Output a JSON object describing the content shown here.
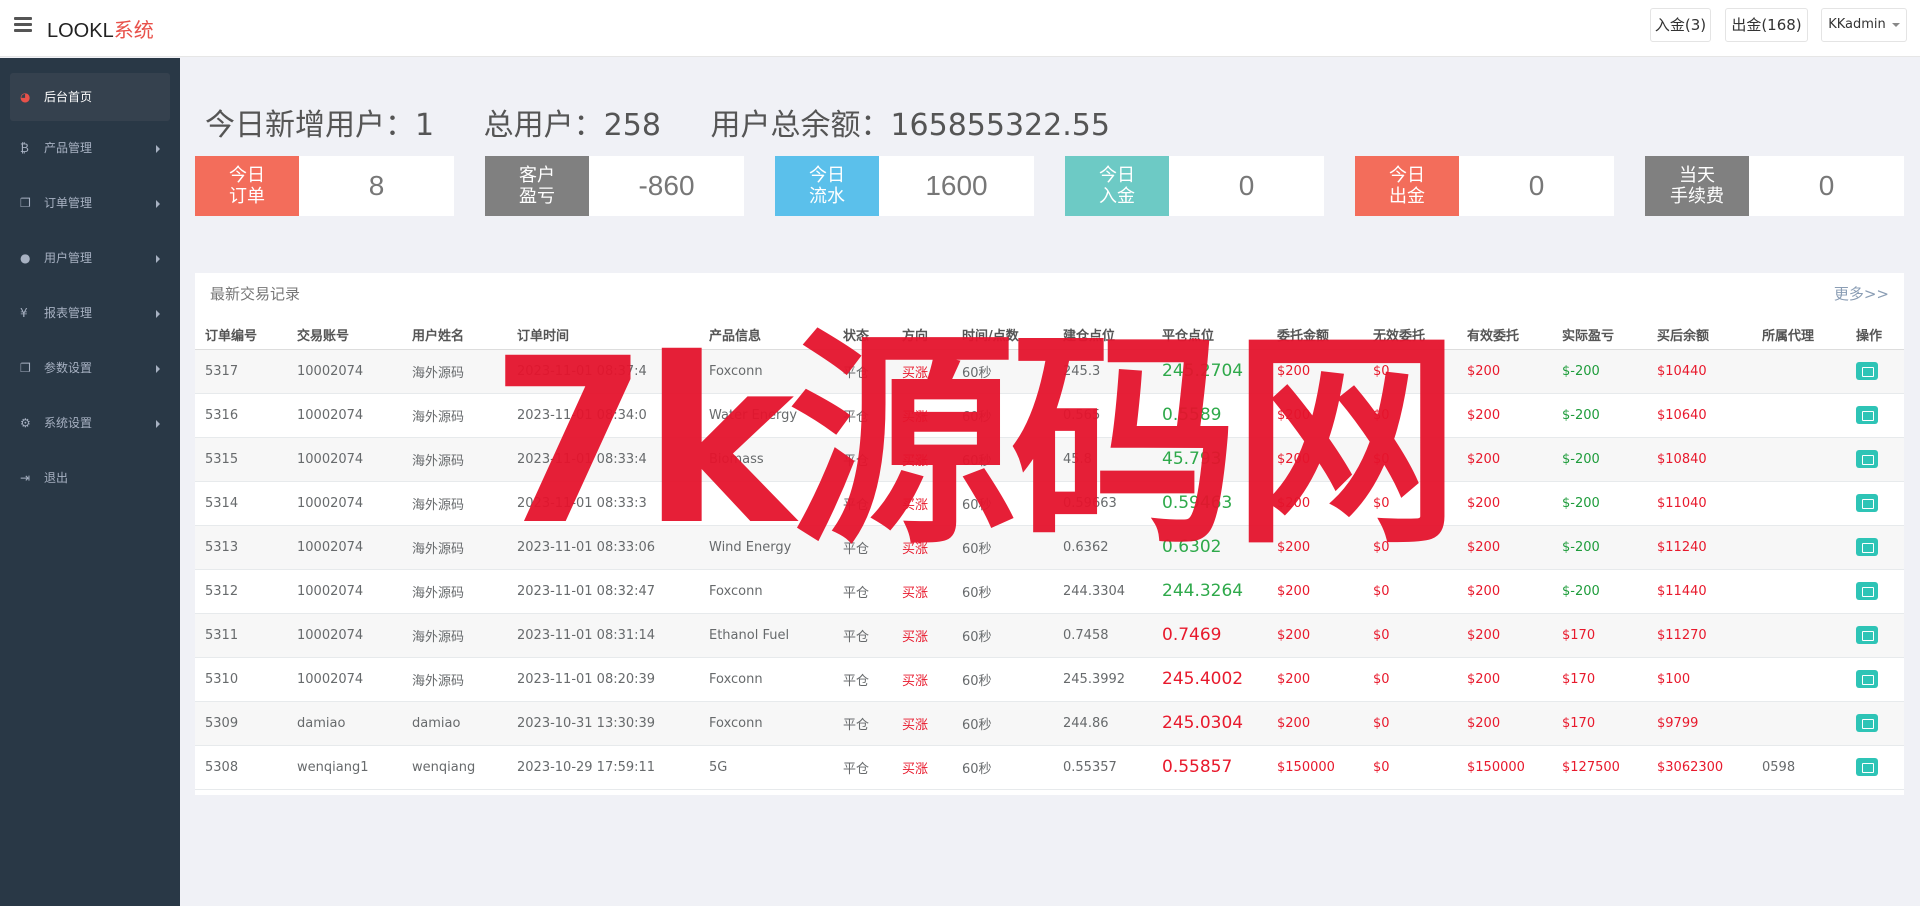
{
  "brand": {
    "name": "LOOKL",
    "suffix": "系统"
  },
  "topbar": {
    "deposit_label": "入金(3)",
    "withdraw_label": "出金(168)",
    "admin_label": "KKadmin"
  },
  "sidebar": {
    "items": [
      {
        "label": "后台首页",
        "icon": "dashboard-icon"
      },
      {
        "label": "产品管理",
        "icon": "bitcoin-icon"
      },
      {
        "label": "订单管理",
        "icon": "copy-icon"
      },
      {
        "label": "用户管理",
        "icon": "user-icon"
      },
      {
        "label": "报表管理",
        "icon": "yen-icon"
      },
      {
        "label": "参数设置",
        "icon": "copy-icon"
      },
      {
        "label": "系统设置",
        "icon": "gears-icon"
      },
      {
        "label": "退出",
        "icon": "sign-out-icon"
      }
    ]
  },
  "summary": {
    "new_users": "今日新增用户：1",
    "total_users": "总用户：258",
    "total_balance": "用户总余额：165855322.55"
  },
  "stats": [
    {
      "label1": "今日",
      "label2": "订单",
      "value": "8",
      "color": "#f36d5b"
    },
    {
      "label1": "客户",
      "label2": "盈亏",
      "value": "-860",
      "color": "#808080"
    },
    {
      "label1": "今日",
      "label2": "流水",
      "value": "1600",
      "color": "#5bc0eb"
    },
    {
      "label1": "今日",
      "label2": "入金",
      "value": "0",
      "color": "#6dcac5"
    },
    {
      "label1": "今日",
      "label2": "出金",
      "value": "0",
      "color": "#f36d5b"
    },
    {
      "label1": "当天",
      "label2": "手续费",
      "value": "0",
      "color": "#808080"
    }
  ],
  "panel": {
    "title": "最新交易记录",
    "more": "更多>>"
  },
  "table": {
    "headers": [
      "订单编号",
      "交易账号",
      "用户姓名",
      "订单时间",
      "产品信息",
      "状态",
      "方向",
      "时间/点数",
      "建仓点位",
      "平仓点位",
      "委托金额",
      "无效委托",
      "有效委托",
      "实际盈亏",
      "买后余额",
      "所属代理",
      "操作"
    ],
    "rows": [
      {
        "id": "5317",
        "account": "10002074",
        "name": "海外源码",
        "time": "2023-11-01 08:37:4",
        "product": "Foxconn",
        "status": "平仓",
        "direction": "买涨",
        "period": "60秒",
        "open": "245.3",
        "close": "245.2704",
        "close_dir": "down",
        "amount": "$200",
        "invalid": "$0",
        "valid": "$200",
        "pnl": "$-200",
        "pnl_dir": "loss",
        "balance": "$10440",
        "agent": ""
      },
      {
        "id": "5316",
        "account": "10002074",
        "name": "海外源码",
        "time": "2023-11-01 08:34:0",
        "product": "Water Energy",
        "status": "平仓",
        "direction": "买涨",
        "period": "60秒",
        "open": "0.565",
        "close": "0.5589",
        "close_dir": "down",
        "amount": "$200",
        "invalid": "$0",
        "valid": "$200",
        "pnl": "$-200",
        "pnl_dir": "loss",
        "balance": "$10640",
        "agent": ""
      },
      {
        "id": "5315",
        "account": "10002074",
        "name": "海外源码",
        "time": "2023-11-01 08:33:4",
        "product": "Biomass",
        "status": "平仓",
        "direction": "买涨",
        "period": "60秒",
        "open": "45.8",
        "close": "45.793",
        "close_dir": "down",
        "amount": "$200",
        "invalid": "$0",
        "valid": "$200",
        "pnl": "$-200",
        "pnl_dir": "loss",
        "balance": "$10840",
        "agent": ""
      },
      {
        "id": "5314",
        "account": "10002074",
        "name": "海外源码",
        "time": "2023-11-01 08:33:3",
        "product": "",
        "status": "平仓",
        "direction": "买涨",
        "period": "60秒",
        "open": "0.59663",
        "close": "0.59463",
        "close_dir": "down",
        "amount": "$200",
        "invalid": "$0",
        "valid": "$200",
        "pnl": "$-200",
        "pnl_dir": "loss",
        "balance": "$11040",
        "agent": ""
      },
      {
        "id": "5313",
        "account": "10002074",
        "name": "海外源码",
        "time": "2023-11-01 08:33:06",
        "product": "Wind Energy",
        "status": "平仓",
        "direction": "买涨",
        "period": "60秒",
        "open": "0.6362",
        "close": "0.6302",
        "close_dir": "down",
        "amount": "$200",
        "invalid": "$0",
        "valid": "$200",
        "pnl": "$-200",
        "pnl_dir": "loss",
        "balance": "$11240",
        "agent": ""
      },
      {
        "id": "5312",
        "account": "10002074",
        "name": "海外源码",
        "time": "2023-11-01 08:32:47",
        "product": "Foxconn",
        "status": "平仓",
        "direction": "买涨",
        "period": "60秒",
        "open": "244.3304",
        "close": "244.3264",
        "close_dir": "down",
        "amount": "$200",
        "invalid": "$0",
        "valid": "$200",
        "pnl": "$-200",
        "pnl_dir": "loss",
        "balance": "$11440",
        "agent": ""
      },
      {
        "id": "5311",
        "account": "10002074",
        "name": "海外源码",
        "time": "2023-11-01 08:31:14",
        "product": "Ethanol Fuel",
        "status": "平仓",
        "direction": "买涨",
        "period": "60秒",
        "open": "0.7458",
        "close": "0.7469",
        "close_dir": "up",
        "amount": "$200",
        "invalid": "$0",
        "valid": "$200",
        "pnl": "$170",
        "pnl_dir": "gain",
        "balance": "$11270",
        "agent": ""
      },
      {
        "id": "5310",
        "account": "10002074",
        "name": "海外源码",
        "time": "2023-11-01 08:20:39",
        "product": "Foxconn",
        "status": "平仓",
        "direction": "买涨",
        "period": "60秒",
        "open": "245.3992",
        "close": "245.4002",
        "close_dir": "up",
        "amount": "$200",
        "invalid": "$0",
        "valid": "$200",
        "pnl": "$170",
        "pnl_dir": "gain",
        "balance": "$100",
        "agent": ""
      },
      {
        "id": "5309",
        "account": "damiao",
        "name": "damiao",
        "time": "2023-10-31 13:30:39",
        "product": "Foxconn",
        "status": "平仓",
        "direction": "买涨",
        "period": "60秒",
        "open": "244.86",
        "close": "245.0304",
        "close_dir": "up",
        "amount": "$200",
        "invalid": "$0",
        "valid": "$200",
        "pnl": "$170",
        "pnl_dir": "gain",
        "balance": "$9799",
        "agent": ""
      },
      {
        "id": "5308",
        "account": "wenqiang1",
        "name": "wenqiang",
        "time": "2023-10-29 17:59:11",
        "product": "5G",
        "status": "平仓",
        "direction": "买涨",
        "period": "60秒",
        "open": "0.55357",
        "close": "0.55857",
        "close_dir": "up",
        "amount": "$150000",
        "invalid": "$0",
        "valid": "$150000",
        "pnl": "$127500",
        "pnl_dir": "gain",
        "balance": "$3062300",
        "agent": "0598"
      }
    ]
  },
  "watermark": "7k源码网"
}
